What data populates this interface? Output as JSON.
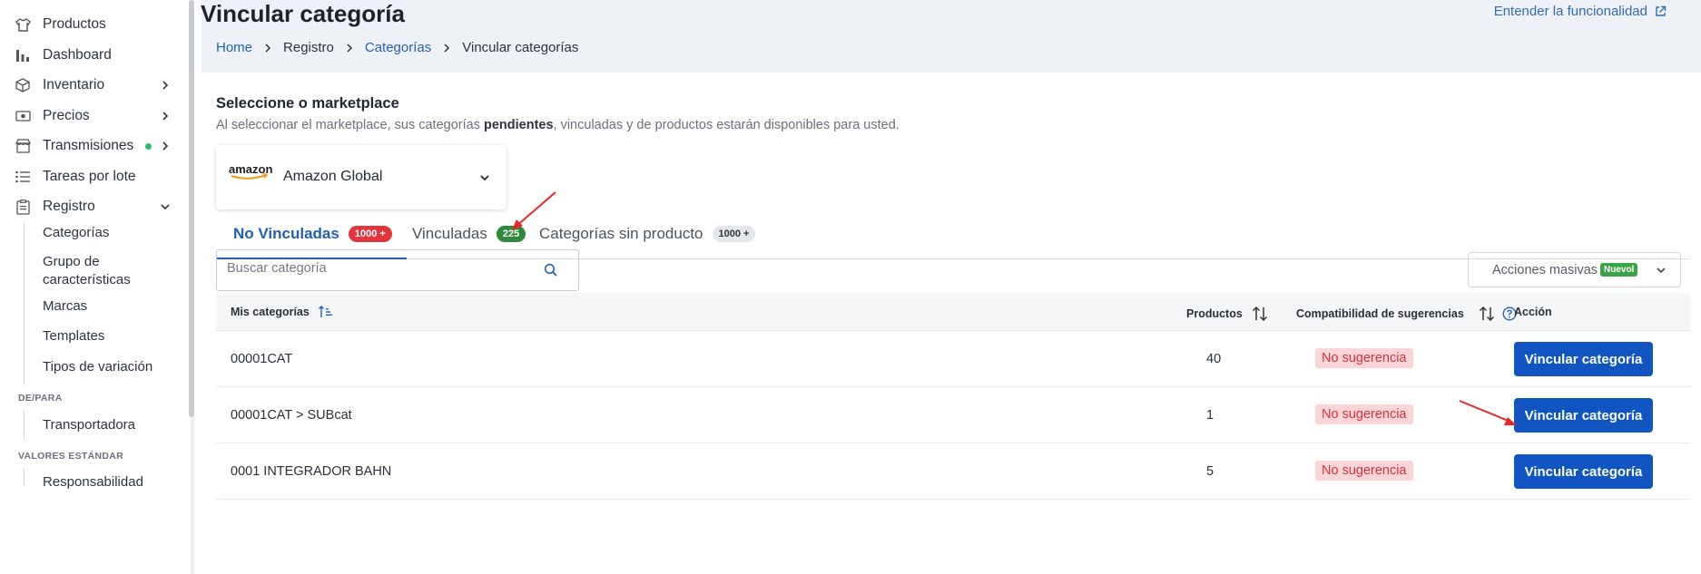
{
  "sidebar": {
    "items": [
      {
        "label": "Productos",
        "icon": "shirt-icon"
      },
      {
        "label": "Dashboard",
        "icon": "bar-chart-icon"
      },
      {
        "label": "Inventario",
        "icon": "box-icon"
      },
      {
        "label": "Precios",
        "icon": "money-icon"
      },
      {
        "label": "Transmisiones",
        "icon": "store-icon"
      },
      {
        "label": "Tareas por lote",
        "icon": "list-icon"
      },
      {
        "label": "Registro",
        "icon": "clipboard-icon"
      }
    ],
    "registro_sub": [
      "Categorías",
      "Grupo de características",
      "Marcas",
      "Templates",
      "Tipos de variación"
    ],
    "section_depara": "DE/PARA",
    "depara_items": [
      "Transportadora"
    ],
    "section_valores": "VALORES ESTÁNDAR",
    "valores_items": [
      "Responsabilidad"
    ]
  },
  "header": {
    "title": "Vincular categoría",
    "help_link": "Entender la funcionalidad"
  },
  "breadcrumb": [
    "Home",
    "Registro",
    "Categorías",
    "Vincular categorías"
  ],
  "marketplace": {
    "title": "Seleccione o marketplace",
    "desc_pre": "Al seleccionar el marketplace, sus categorías ",
    "desc_bold": "pendientes",
    "desc_post": ", vinculadas y de productos estarán disponibles para usted.",
    "logo_text": "amazon",
    "selected": "Amazon Global"
  },
  "tabs": [
    {
      "label": "No Vinculadas",
      "badge": "1000 +",
      "active": true
    },
    {
      "label": "Vinculadas",
      "badge": "225",
      "active": false
    },
    {
      "label": "Categorías sin producto",
      "badge": "1000 +",
      "active": false
    }
  ],
  "search": {
    "placeholder": "Buscar categoría"
  },
  "bulk_actions": {
    "label": "Acciones masivas",
    "badge": "Nuevol"
  },
  "table": {
    "headers": {
      "categories": "Mis categorías",
      "products": "Productos",
      "compat": "Compatibilidad de sugerencias",
      "action": "Acción"
    },
    "rows": [
      {
        "name": "00001CAT",
        "products": "40",
        "compat": "No sugerencia",
        "action": "Vincular categoría"
      },
      {
        "name": "00001CAT > SUBcat",
        "products": "1",
        "compat": "No sugerencia",
        "action": "Vincular categoría"
      },
      {
        "name": "0001 INTEGRADOR BAHN",
        "products": "5",
        "compat": "No sugerencia",
        "action": "Vincular categoría"
      }
    ]
  },
  "colors": {
    "primary": "#1055c2",
    "link": "#2462b0",
    "danger_badge": "#e2353c",
    "success_badge": "#2d8a3a",
    "annotation_arrow": "#e8262a"
  }
}
